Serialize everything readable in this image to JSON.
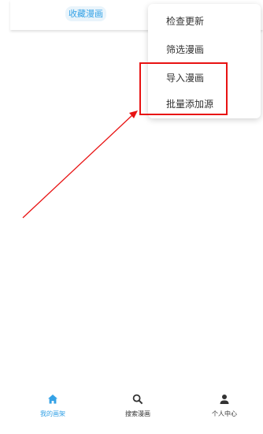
{
  "top_tabs": [
    {
      "label": "收藏漫画",
      "active": true
    }
  ],
  "menu": {
    "items": [
      {
        "label": "检查更新"
      },
      {
        "label": "筛选漫画"
      },
      {
        "label": "导入漫画"
      },
      {
        "label": "批量添加源"
      }
    ]
  },
  "bottom_nav": {
    "items": [
      {
        "label": "我的画架",
        "icon": "home-icon",
        "active": true
      },
      {
        "label": "搜索漫画",
        "icon": "search-icon",
        "active": false
      },
      {
        "label": "个人中心",
        "icon": "person-icon",
        "active": false
      }
    ]
  },
  "colors": {
    "accent": "#35a2e6",
    "annotation": "#e81212",
    "text": "#333333",
    "background": "#ffffff"
  }
}
